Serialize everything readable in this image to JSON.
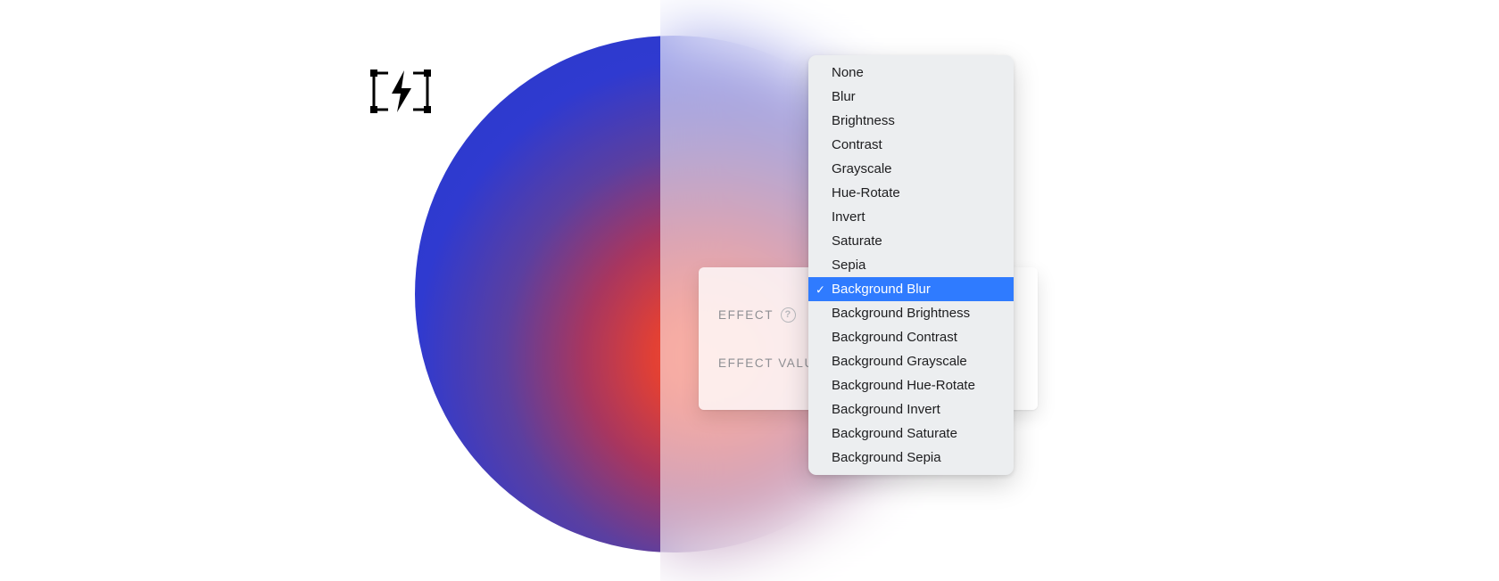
{
  "card": {
    "effect_label": "EFFECT",
    "effect_value_label": "EFFECT VALUE"
  },
  "menu": {
    "selected_index": 9,
    "items": [
      "None",
      "Blur",
      "Brightness",
      "Contrast",
      "Grayscale",
      "Hue-Rotate",
      "Invert",
      "Saturate",
      "Sepia",
      "Background Blur",
      "Background Brightness",
      "Background Contrast",
      "Background Grayscale",
      "Background Hue-Rotate",
      "Background Invert",
      "Background Saturate",
      "Background Sepia"
    ]
  }
}
